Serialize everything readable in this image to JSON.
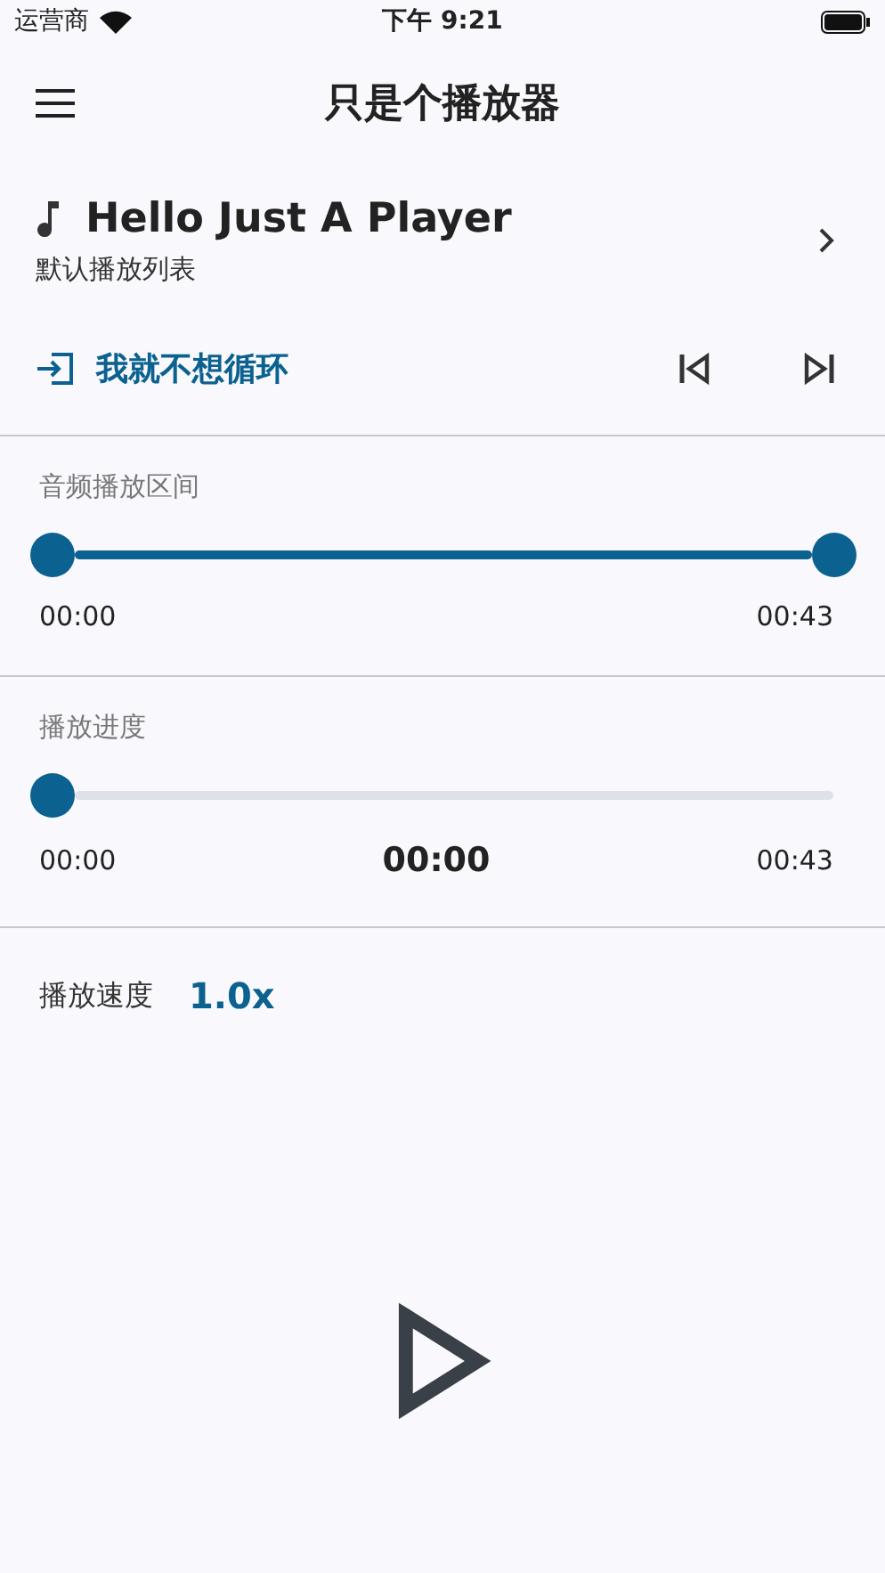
{
  "status_bar": {
    "carrier": "运营商",
    "time": "下午 9:21"
  },
  "header": {
    "title": "只是个播放器"
  },
  "track": {
    "title": "Hello Just A Player",
    "playlist": "默认播放列表"
  },
  "loop": {
    "label": "我就不想循环"
  },
  "range": {
    "label": "音频播放区间",
    "thumbs": [
      {
        "level": 0
      },
      {
        "level": 1
      }
    ],
    "start": "00:00",
    "end": "00:43"
  },
  "progress": {
    "label": "播放进度",
    "level": 0,
    "start": "00:00",
    "current": "00:00",
    "end": "00:43"
  },
  "speed": {
    "label": "播放速度",
    "value": "1.0x"
  }
}
